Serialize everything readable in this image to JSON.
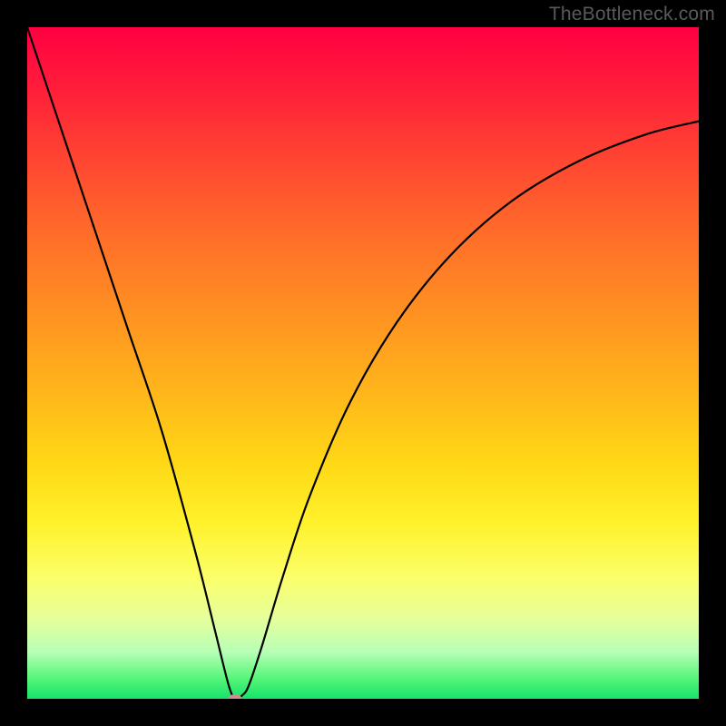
{
  "watermark": "TheBottleneck.com",
  "colors": {
    "frame": "#000000",
    "curve": "#000000",
    "dot": "#cf8e8e"
  },
  "chart_data": {
    "type": "line",
    "title": "",
    "xlabel": "",
    "ylabel": "",
    "xlim": [
      0,
      100
    ],
    "ylim": [
      0,
      100
    ],
    "grid": false,
    "legend": false,
    "series": [
      {
        "name": "bottleneck-curve",
        "x": [
          0,
          5,
          10,
          15,
          20,
          25,
          28,
          30,
          31,
          32,
          33,
          35,
          38,
          42,
          48,
          55,
          63,
          72,
          82,
          92,
          100
        ],
        "y": [
          100,
          85,
          70,
          55,
          40,
          22,
          10,
          2,
          0,
          0.5,
          2,
          8,
          18,
          30,
          44,
          56,
          66,
          74,
          80,
          84,
          86
        ]
      }
    ],
    "marker": {
      "x": 31,
      "y": 0
    }
  }
}
